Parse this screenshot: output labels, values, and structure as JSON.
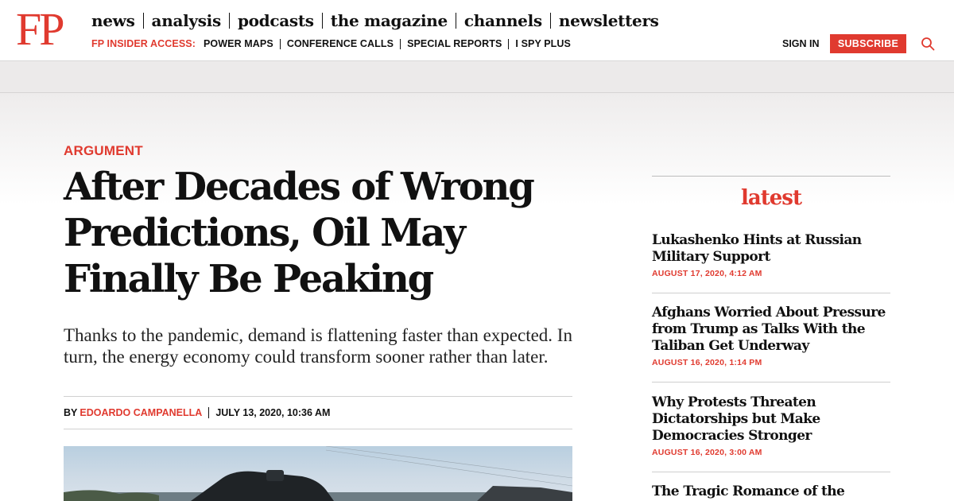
{
  "header": {
    "logo": "FP",
    "main_nav": [
      "news",
      "analysis",
      "podcasts",
      "the magazine",
      "channels",
      "newsletters"
    ],
    "insider_label": "FP INSIDER ACCESS:",
    "sub_nav": [
      "POWER MAPS",
      "CONFERENCE CALLS",
      "SPECIAL REPORTS",
      "I SPY PLUS"
    ],
    "sign_in": "SIGN IN",
    "subscribe": "SUBSCRIBE",
    "search_icon": "search-icon"
  },
  "article": {
    "kicker": "ARGUMENT",
    "headline": "After Decades of Wrong Predictions, Oil May Finally Be Peaking",
    "dek": "Thanks to the pandemic, demand is flattening faster than expected. In turn, the energy economy could transform sooner rather than later.",
    "by": "BY",
    "author": "EDOARDO CAMPANELLA",
    "date": "JULY 13, 2020, 10:36 AM"
  },
  "sidebar": {
    "title": "latest",
    "stories": [
      {
        "title": "Lukashenko Hints at Russian Military Support",
        "time": "AUGUST 17, 2020, 4:12 AM"
      },
      {
        "title": "Afghans Worried About Pressure from Trump as Talks With the Taliban Get Underway",
        "time": "AUGUST 16, 2020, 1:14 PM"
      },
      {
        "title": "Why Protests Threaten Dictatorships but Make Democracies Stronger",
        "time": "AUGUST 16, 2020, 3:00 AM"
      },
      {
        "title": "The Tragic Romance of the Middle-",
        "time": ""
      }
    ]
  },
  "colors": {
    "brand_red": "#e03a2f"
  }
}
